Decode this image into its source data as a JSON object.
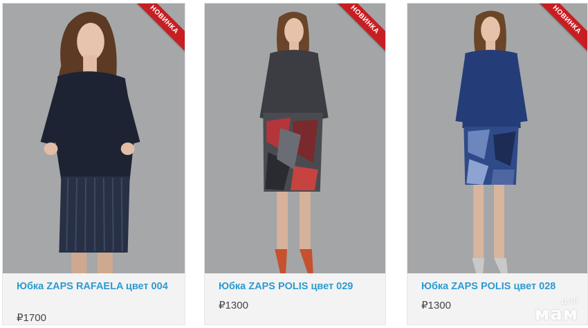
{
  "products": [
    {
      "badge": "НОВИНКА",
      "title": "Юбка ZAPS RAFAELA цвет 004",
      "price": "₽1700"
    },
    {
      "badge": "НОВИНКА",
      "title": "Юбка ZAPS POLIS цвет 029",
      "price": "₽1300"
    },
    {
      "badge": "НОВИНКА",
      "title": "Юбка ZAPS POLIS цвет 028",
      "price": "₽1300"
    }
  ],
  "watermark": {
    "line1": "для",
    "line2": "мам"
  },
  "colors": {
    "link": "#2b9bd1",
    "badge": "#c81e22",
    "photo_bg": "#a4a5a7",
    "info_bg": "#f3f3f3"
  }
}
